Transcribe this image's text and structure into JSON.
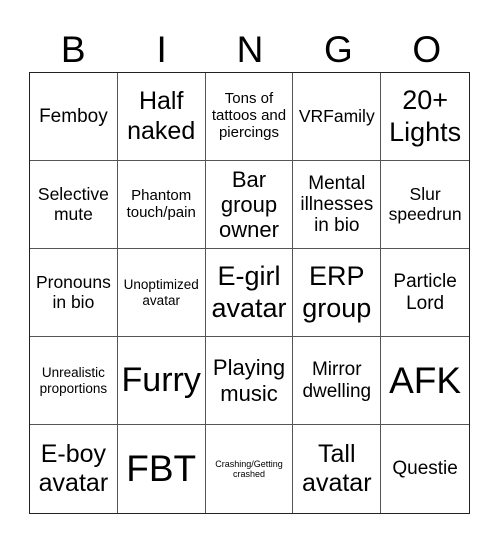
{
  "title_letters": [
    "B",
    "I",
    "N",
    "G",
    "O"
  ],
  "cells": [
    "Femboy",
    "Half naked",
    "Tons of tattoos and piercings",
    "VRFamily",
    "20+ Lights",
    "Selective mute",
    "Phantom touch/pain",
    "Bar group owner",
    "Mental illnesses in bio",
    "Slur speedrun",
    "Pronouns in bio",
    "Unoptimized avatar",
    "E-girl avatar",
    "ERP group",
    "Particle Lord",
    "Unrealistic proportions",
    "Furry",
    "Playing music",
    "Mirror dwelling",
    "AFK",
    "E-boy avatar",
    "FBT",
    "Crashing/Getting crashed",
    "Tall avatar",
    "Questie"
  ]
}
